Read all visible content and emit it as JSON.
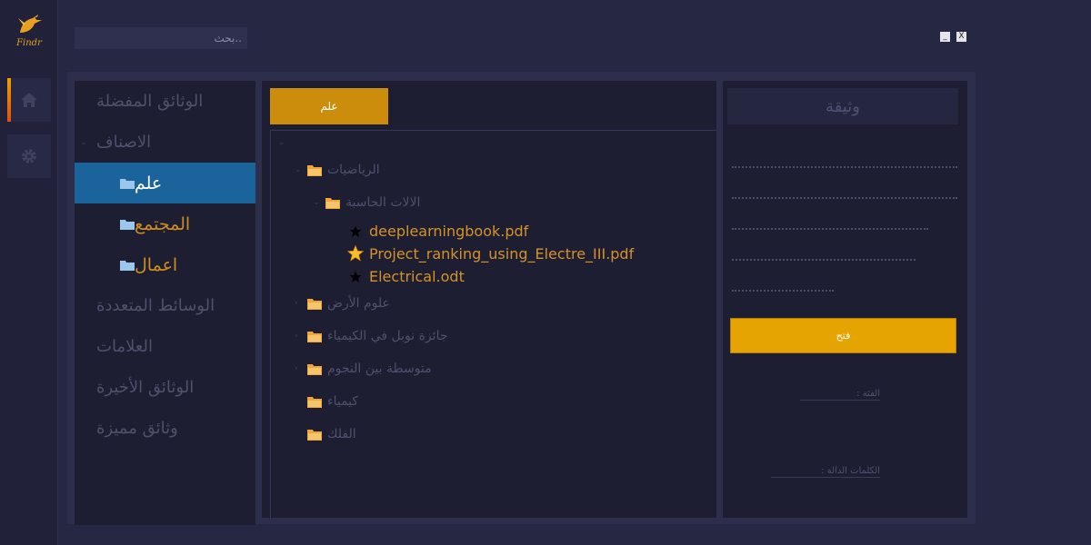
{
  "app": {
    "logo_text": "Findr"
  },
  "search": {
    "placeholder": "..بحث"
  },
  "window": {
    "minimize": "_",
    "close": "X"
  },
  "sidebar": {
    "items": [
      {
        "label": "الوثائق المفضلة"
      },
      {
        "label": "الاصناف"
      },
      {
        "label": "علم"
      },
      {
        "label": "المجتمع"
      },
      {
        "label": "اعمال"
      },
      {
        "label": "الوسائط المتعددة"
      },
      {
        "label": "العلامات"
      },
      {
        "label": "الوثائق الأخيرة"
      },
      {
        "label": "وثائق مميزة"
      }
    ]
  },
  "main": {
    "tab_label": "علم",
    "tree": [
      {
        "label": "الرياضيات"
      },
      {
        "label": "الالات الحاسبة"
      },
      {
        "label": "deeplearningbook.pdf"
      },
      {
        "label": "Project_ranking_using_Electre_III.pdf"
      },
      {
        "label": "Electrical.odt"
      },
      {
        "label": "علوم الأرض"
      },
      {
        "label": "جائزة نوبل في الكيمياء"
      },
      {
        "label": "متوسطة بين النجوم"
      },
      {
        "label": "كيمياء"
      },
      {
        "label": "الفلك"
      }
    ]
  },
  "details": {
    "title": "وثيقة",
    "open_label": "فتح",
    "category_label": "الفئة :",
    "keywords_label": "الكلمات الدالة :"
  },
  "colors": {
    "accent": "#e6a402",
    "active_item": "#1b639b",
    "panel": "#1d1e31",
    "background": "#262742"
  }
}
